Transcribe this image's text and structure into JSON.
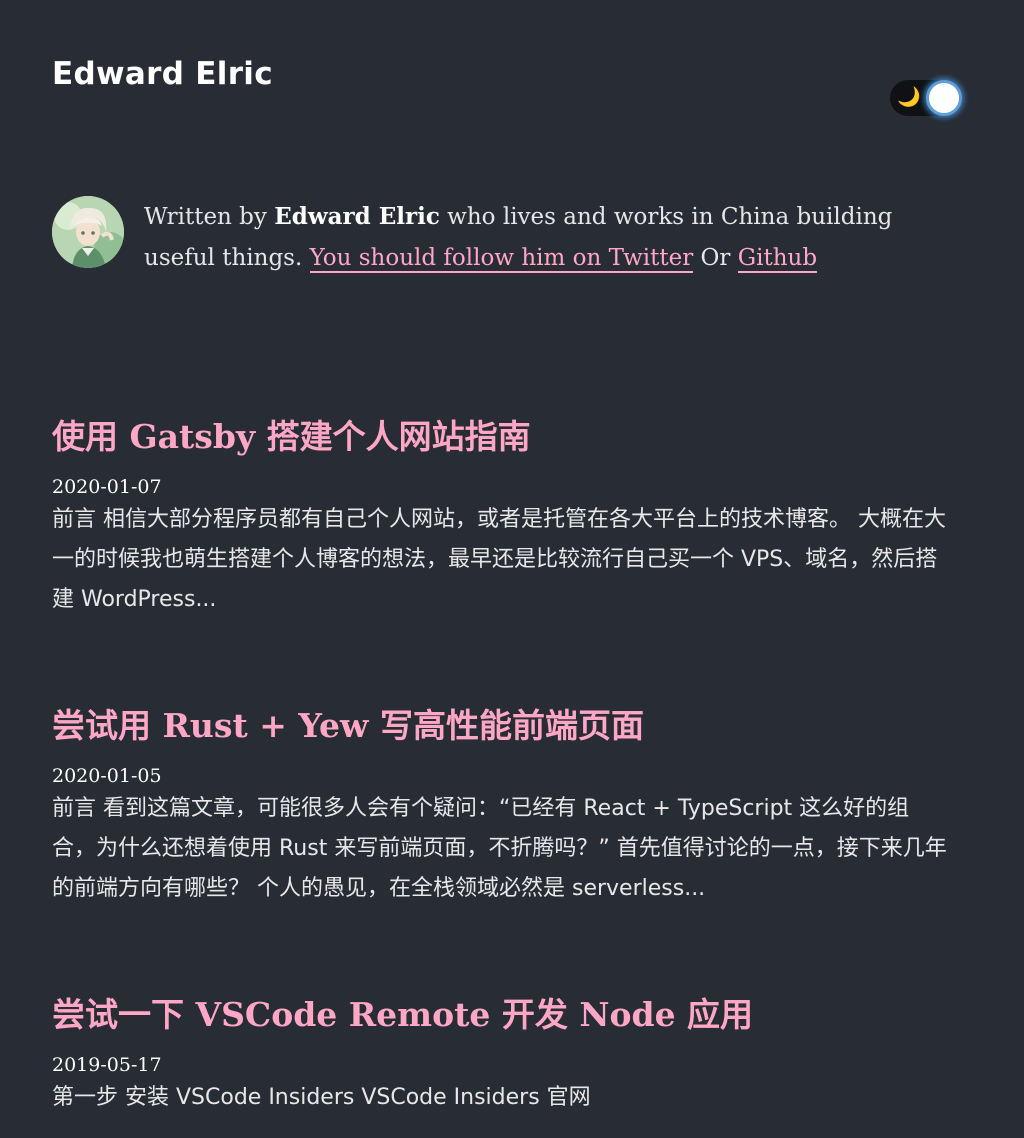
{
  "header": {
    "site_title": "Edward Elric",
    "theme_icon": "moon-icon"
  },
  "bio": {
    "prefix": "Written by ",
    "author": "Edward Elric",
    "middle": " who lives and works in China building useful things. ",
    "twitter_link": "You should follow him on Twitter",
    "or": " Or ",
    "github_link": "Github"
  },
  "posts": [
    {
      "title": "使用 Gatsby 搭建个人网站指南",
      "date": "2020-01-07",
      "excerpt": "前言 相信大部分程序员都有自己个人网站，或者是托管在各大平台上的技术博客。 大概在大一的时候我也萌生搭建个人博客的想法，最早还是比较流行自己买一个 VPS、域名，然后搭建 WordPress..."
    },
    {
      "title": "尝试用 Rust + Yew 写高性能前端页面",
      "date": "2020-01-05",
      "excerpt": "前言 看到这篇文章，可能很多人会有个疑问：“已经有 React + TypeScript 这么好的组合，为什么还想着使用 Rust 来写前端页面，不折腾吗？” 首先值得讨论的一点，接下来几年的前端方向有哪些？ 个人的愚见，在全栈领域必然是 serverless..."
    },
    {
      "title": "尝试一下 VSCode Remote 开发 Node 应用",
      "date": "2019-05-17",
      "excerpt": "第一步 安装 VSCode Insiders VSCode Insiders 官网"
    }
  ],
  "colors": {
    "background": "#282c35",
    "accent": "#ffa7c4",
    "text": "#e8e8e8"
  }
}
